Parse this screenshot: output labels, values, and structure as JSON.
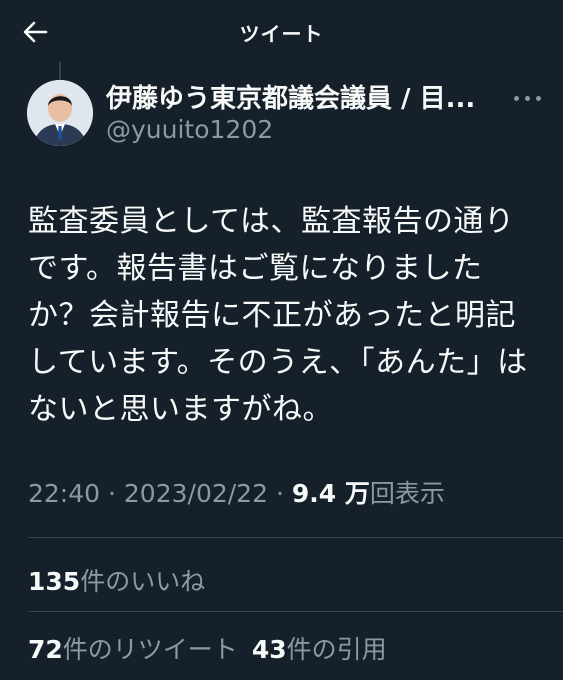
{
  "header": {
    "title": "ツイート",
    "back_icon": "arrow-left-icon"
  },
  "author": {
    "display_name": "伊藤ゆう東京都議会議員 / 目...",
    "handle": "@yuuito1202",
    "more_icon": "more-dots-icon"
  },
  "tweet": {
    "text": "監査委員としては、監査報告の通りです。報告書はご覧になりましたか？会計報告に不正があったと明記しています。そのうえ、「あんた」はないと思いますがね。"
  },
  "meta": {
    "time": "22:40",
    "separator": "·",
    "date": "2023/02/22",
    "views_count": "9.4 万",
    "views_label": "回表示"
  },
  "stats": {
    "likes_count": "135",
    "likes_label": "件のいいね",
    "retweets_count": "72",
    "retweets_label": "件のリツイート",
    "quotes_count": "43",
    "quotes_label": "件の引用"
  },
  "colors": {
    "background": "#15202b",
    "text": "#f7f9f9",
    "muted": "#8b98a5",
    "divider": "#38444d"
  }
}
